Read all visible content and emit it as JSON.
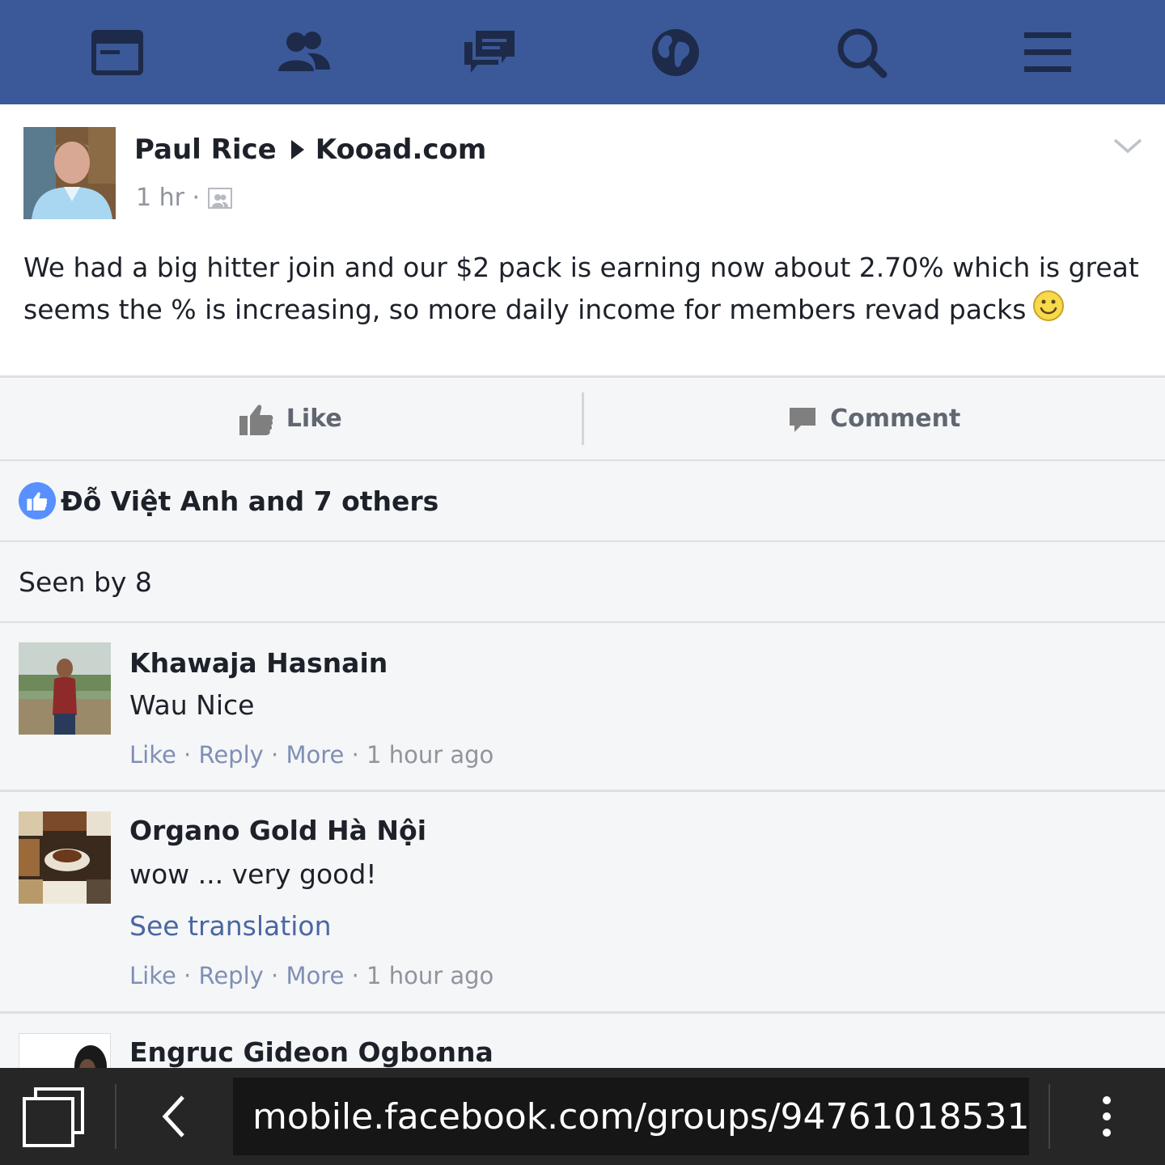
{
  "nav": {
    "icons": [
      "news-feed-icon",
      "friends-icon",
      "messages-icon",
      "notifications-globe-icon",
      "search-icon",
      "menu-icon"
    ]
  },
  "post": {
    "author": "Paul Rice",
    "target": "Kooad.com",
    "time": "1 hr ·",
    "text": "We had a big hitter join and our $2 pack is earning now about 2.70% which is great seems the % is increasing, so more daily income for members revad packs"
  },
  "actions": {
    "like_label": "Like",
    "comment_label": "Comment"
  },
  "likes": {
    "text": "Đỗ Việt Anh and 7 others"
  },
  "seen": {
    "text": "Seen by 8"
  },
  "comments": [
    {
      "name": "Khawaja Hasnain",
      "text": "Wau Nice",
      "like": "Like",
      "reply": "Reply",
      "more": "More",
      "time": "1 hour ago"
    },
    {
      "name": "Organo Gold Hà Nội",
      "text": "wow ... very good!",
      "translation": "See translation",
      "like": "Like",
      "reply": "Reply",
      "more": "More",
      "time": "1 hour ago"
    },
    {
      "name": "Engruc Gideon Ogbonna"
    }
  ],
  "browser": {
    "url": "mobile.facebook.com/groups/94761018531"
  },
  "colors": {
    "nav_bg": "#3b5998",
    "nav_icon": "#1d2a4a",
    "link": "#4b67a1",
    "like_blue": "#5890ff"
  }
}
